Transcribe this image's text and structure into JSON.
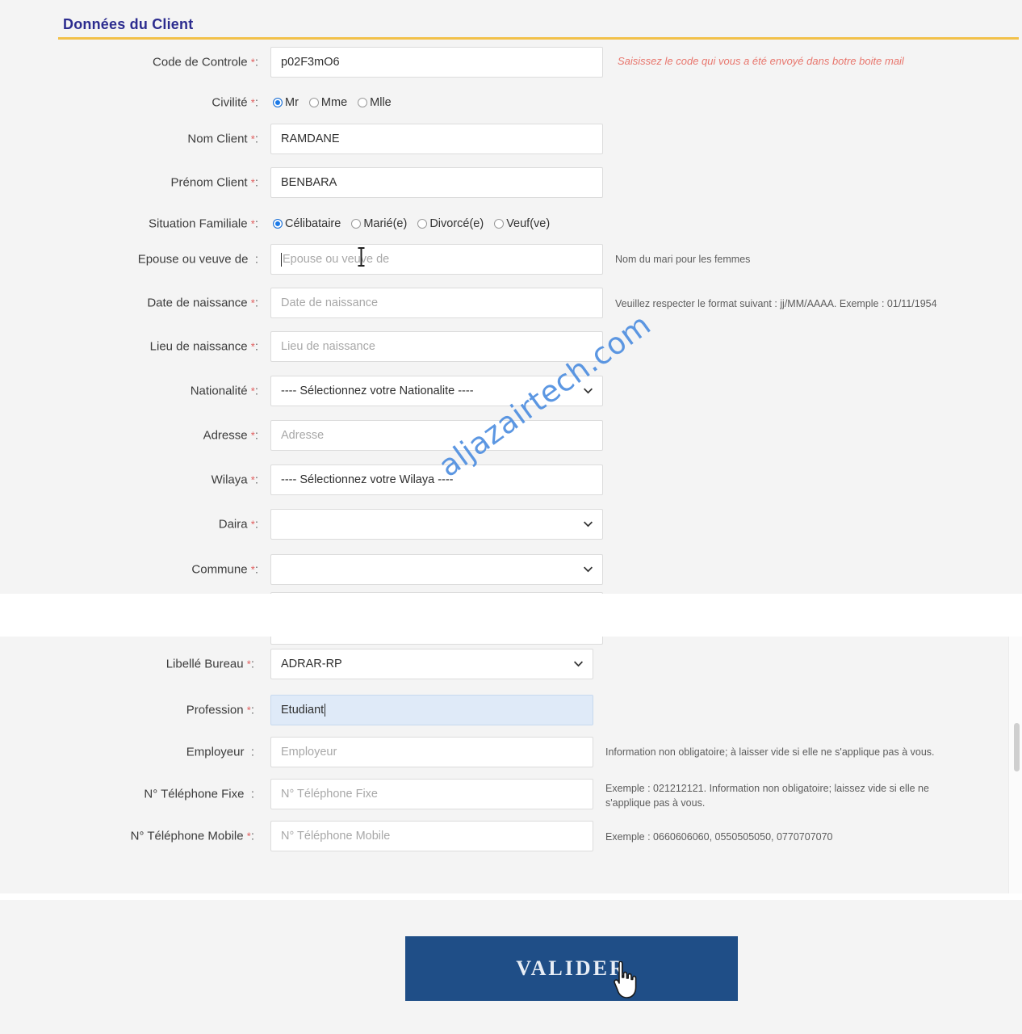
{
  "section_client": {
    "title": "Données du Client",
    "rows": [
      {
        "label": "Code de Controle",
        "required": true,
        "type": "text",
        "value": "p02F3mO6",
        "hint": "Saisissez le code qui vous a été envoyé dans botre boite mail",
        "hint_style": "red"
      },
      {
        "label": "Civilité",
        "required": true,
        "type": "radio",
        "options": [
          "Mr",
          "Mme",
          "Mlle"
        ],
        "selected": "Mr"
      },
      {
        "label": "Nom Client",
        "required": true,
        "type": "text",
        "value": "RAMDANE"
      },
      {
        "label": "Prénom Client",
        "required": true,
        "type": "text",
        "value": "BENBARA"
      },
      {
        "label": "Situation Familiale",
        "required": true,
        "type": "radio",
        "options": [
          "Célibataire",
          "Marié(e)",
          "Divorcé(e)",
          "Veuf(ve)"
        ],
        "selected": "Célibataire"
      },
      {
        "label": "Epouse ou veuve de",
        "required": false,
        "type": "text",
        "value": "",
        "placeholder": "Epouse ou veuve de",
        "focused": true,
        "hint": "Nom du mari pour les femmes"
      },
      {
        "label": "Date de naissance",
        "required": true,
        "type": "text",
        "value": "",
        "placeholder": "Date de naissance",
        "hint": "Veuillez respecter le format suivant : jj/MM/AAAA. Exemple : 01/11/1954"
      },
      {
        "label": "Lieu de naissance",
        "required": true,
        "type": "text",
        "value": "",
        "placeholder": "Lieu de naissance"
      },
      {
        "label": "Nationalité",
        "required": true,
        "type": "select",
        "value": "---- Sélectionnez votre Nationalite ----"
      },
      {
        "label": "Adresse",
        "required": true,
        "type": "text",
        "value": "",
        "placeholder": "Adresse"
      },
      {
        "label": "Wilaya",
        "required": true,
        "type": "select",
        "value": "---- Sélectionnez votre Wilaya ----",
        "no_chevron": true
      },
      {
        "label": "Daira",
        "required": true,
        "type": "select",
        "value": ""
      },
      {
        "label": "Commune",
        "required": true,
        "type": "select",
        "value": ""
      }
    ]
  },
  "section_professional": {
    "rows": [
      {
        "label": "Libellé Bureau",
        "required": true,
        "type": "select",
        "value": "ADRAR-RP"
      },
      {
        "label": "Profession",
        "required": true,
        "type": "text",
        "value": "Etudiant",
        "autofill": true,
        "caret_end": true
      },
      {
        "label": "Employeur",
        "required": false,
        "type": "text",
        "value": "",
        "placeholder": "Employeur",
        "hint": "Information non obligatoire; à laisser vide si elle ne s'applique pas à vous."
      },
      {
        "label": "N° Téléphone Fixe",
        "required": false,
        "type": "text",
        "value": "",
        "placeholder": "N° Téléphone Fixe",
        "hint": "Exemple : 021212121. Information non obligatoire; laissez vide si elle ne s'applique pas à vous."
      },
      {
        "label": "N° Téléphone Mobile",
        "required": true,
        "type": "text",
        "value": "",
        "placeholder": "N° Téléphone Mobile",
        "hint": "Exemple : 0660606060, 0550505050, 0770707070"
      }
    ]
  },
  "footer": {
    "validate_label": "VALIDER"
  },
  "watermark": {
    "text": "aljazairtech.com"
  },
  "colors": {
    "title": "#2c2c8f",
    "title_rule": "#f2c14a",
    "required_star": "#e05a5a",
    "radio_selected": "#1b7ae8",
    "button_bg": "#1f4e87",
    "autofill_bg": "#dfeaf8",
    "hint_red": "#e8766d",
    "watermark": "#4f8fe0",
    "panel_bg": "#f4f4f4"
  }
}
